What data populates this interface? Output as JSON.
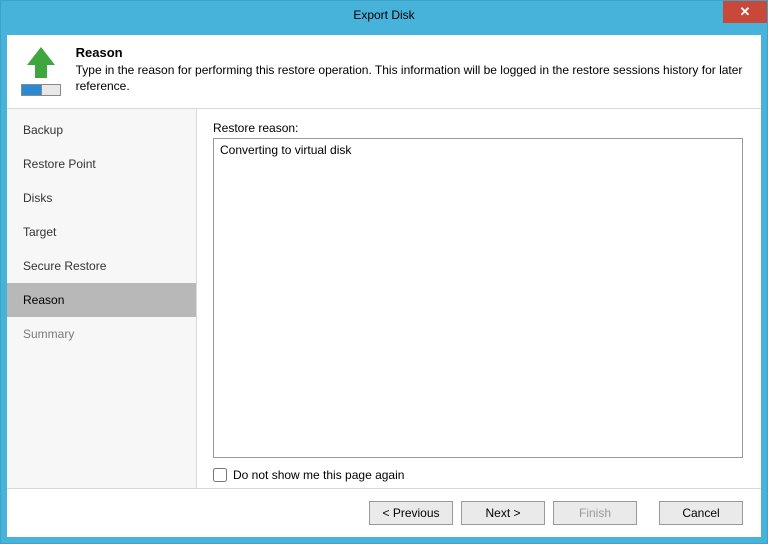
{
  "window": {
    "title": "Export Disk"
  },
  "header": {
    "title": "Reason",
    "description": "Type in the reason for performing this restore operation. This information will be logged in the restore sessions history for later reference."
  },
  "sidebar": {
    "items": [
      {
        "label": "Backup",
        "state": "past"
      },
      {
        "label": "Restore Point",
        "state": "past"
      },
      {
        "label": "Disks",
        "state": "past"
      },
      {
        "label": "Target",
        "state": "past"
      },
      {
        "label": "Secure Restore",
        "state": "past"
      },
      {
        "label": "Reason",
        "state": "active"
      },
      {
        "label": "Summary",
        "state": "future"
      }
    ]
  },
  "main": {
    "field_label": "Restore reason:",
    "reason_text": "Converting to virtual disk",
    "checkbox_label": "Do not show me this page again",
    "checkbox_checked": false
  },
  "footer": {
    "previous": "< Previous",
    "next": "Next >",
    "finish": "Finish",
    "cancel": "Cancel"
  }
}
